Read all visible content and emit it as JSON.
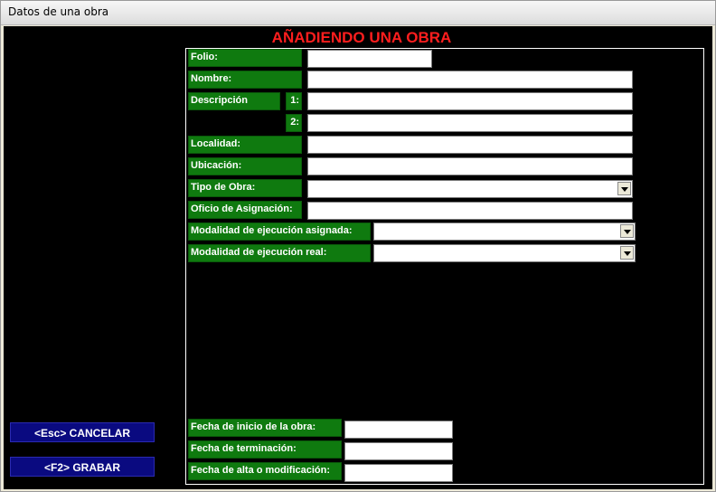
{
  "window": {
    "title": "Datos de una obra"
  },
  "heading": "AÑADIENDO UNA OBRA",
  "labels": {
    "folio": "Folio:",
    "nombre": "Nombre:",
    "descripcion": "Descripción",
    "desc_1": "1:",
    "desc_2": "2:",
    "localidad": "Localidad:",
    "ubicacion": "Ubicación:",
    "tipo_obra": "Tipo de Obra:",
    "oficio_asignacion": "Oficio de Asignación:",
    "modalidad_asignada": "Modalidad de ejecución asignada:",
    "modalidad_real": "Modalidad de ejecución real:",
    "fecha_inicio": "Fecha de inicio de la obra:",
    "fecha_terminacion": "Fecha de terminación:",
    "fecha_alta": "Fecha de alta o modificación:"
  },
  "fields": {
    "folio": "",
    "nombre": "",
    "descripcion_1": "",
    "descripcion_2": "",
    "localidad": "",
    "ubicacion": "",
    "tipo_obra": "",
    "oficio_asignacion": "",
    "modalidad_asignada": "",
    "modalidad_real": "",
    "fecha_inicio": "",
    "fecha_terminacion": "",
    "fecha_alta": ""
  },
  "buttons": {
    "cancelar": "<Esc>  CANCELAR",
    "grabar": "<F2>  GRABAR"
  },
  "colors": {
    "label_bg": "#0f7a0f",
    "heading": "#ff1e1e",
    "button_bg": "#0a0a80",
    "background": "#000000"
  }
}
